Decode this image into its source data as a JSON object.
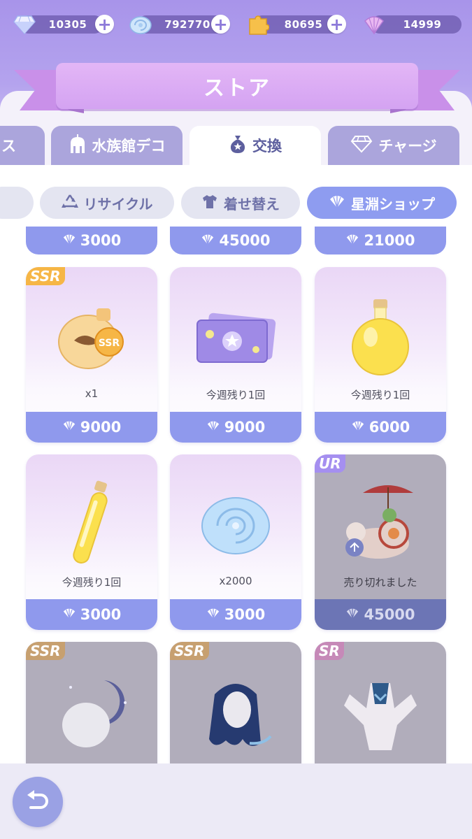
{
  "currencies": [
    {
      "name": "diamond-icon",
      "amount": "10305",
      "has_plus": true
    },
    {
      "name": "shell-icon",
      "amount": "792770",
      "has_plus": true
    },
    {
      "name": "puzzle-icon",
      "amount": "80695",
      "has_plus": true
    },
    {
      "name": "star-shell-icon",
      "amount": "14999",
      "has_plus": false
    }
  ],
  "plus_label": "+",
  "header": {
    "title": "ストア"
  },
  "tabs": [
    {
      "label": "ス",
      "icon": "none",
      "active": false
    },
    {
      "label": "水族館デコ",
      "icon": "building-icon",
      "active": false
    },
    {
      "label": "交換",
      "icon": "money-bag-icon",
      "active": true
    },
    {
      "label": "チャージ",
      "icon": "diamond-icon",
      "active": false
    }
  ],
  "subtabs": [
    {
      "label": "リサイクル",
      "icon": "recycle-icon",
      "active": false
    },
    {
      "label": "着せ替え",
      "icon": "shirt-icon",
      "active": false
    },
    {
      "label": "星淵ショップ",
      "icon": "shell-icon",
      "active": true
    }
  ],
  "top_prices": [
    "3000",
    "45000",
    "21000"
  ],
  "items": [
    {
      "badge": "SSR",
      "caption": "x1",
      "price": "9000",
      "art": "ssr-potion-icon",
      "sold_out": false
    },
    {
      "badge": "",
      "caption": "今週残り1回",
      "price": "9000",
      "art": "ticket-icon",
      "sold_out": false
    },
    {
      "badge": "",
      "caption": "今週残り1回",
      "price": "6000",
      "art": "round-flask-icon",
      "sold_out": false
    },
    {
      "badge": "",
      "caption": "今週残り1回",
      "price": "3000",
      "art": "vial-icon",
      "sold_out": false
    },
    {
      "badge": "",
      "caption": "x2000",
      "price": "3000",
      "art": "nautilus-shell-icon",
      "sold_out": false
    },
    {
      "badge": "UR",
      "caption": "売り切れました",
      "price": "45000",
      "art": "snail-umbrella-icon",
      "sold_out": true
    },
    {
      "badge": "SSR",
      "caption": "",
      "price": "",
      "art": "moon-head-icon",
      "sold_out": true
    },
    {
      "badge": "SSR",
      "caption": "",
      "price": "",
      "art": "hair-icon",
      "sold_out": true
    },
    {
      "badge": "SR",
      "caption": "",
      "price": "",
      "art": "dress-icon",
      "sold_out": true
    }
  ],
  "colors": {
    "accent": "#8f99ed",
    "header_purple": "#a894ea",
    "badge_ssr": "#f6b646",
    "badge_ur": "#a58ff0"
  }
}
